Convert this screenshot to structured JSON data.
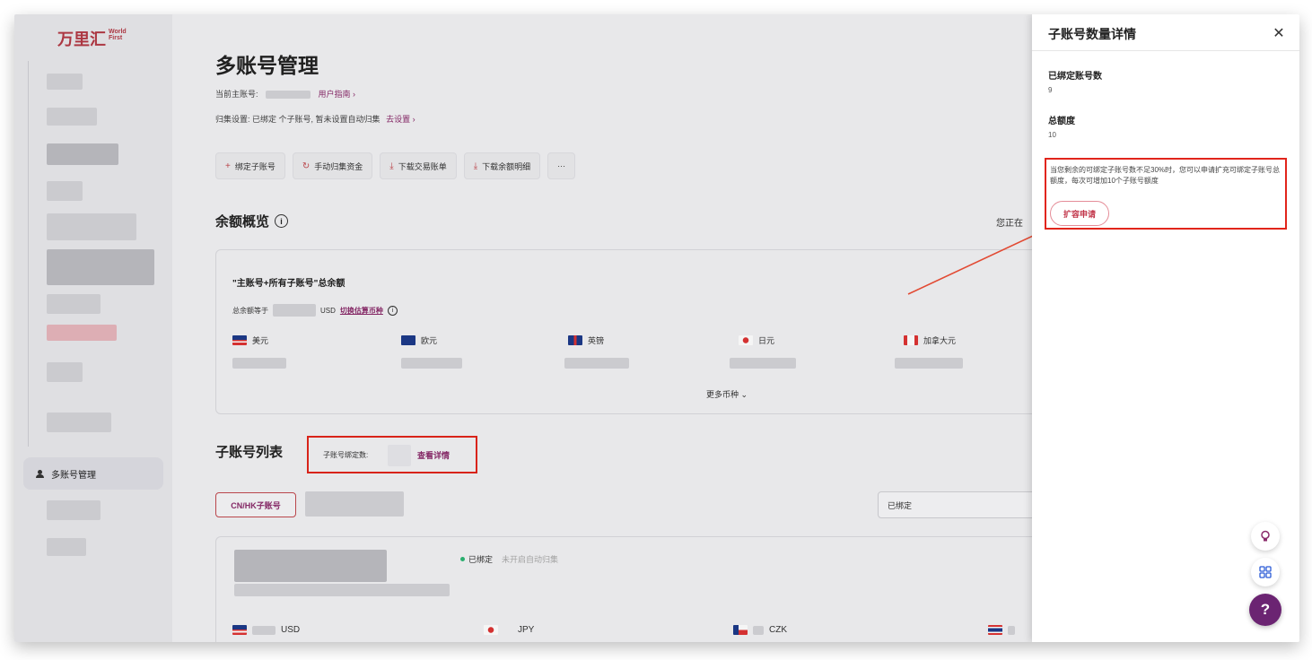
{
  "brand": {
    "name": "万里汇",
    "sub": "World First"
  },
  "sidebar": {
    "active_item": "多账号管理"
  },
  "page": {
    "title": "多账号管理",
    "main_account_label": "当前主账号:",
    "user_guide": "用户指南 ›",
    "collect_settings_prefix": "归集设置: 已绑定",
    "collect_settings_suffix": "个子账号, 暂未设置自动归集",
    "go_settings": "去设置 ›"
  },
  "toolbar": {
    "bind_sub": "绑定子账号",
    "manual_collect": "手动归集资金",
    "download_statement": "下载交易账单",
    "download_balance": "下载余额明细",
    "more": "···"
  },
  "balance": {
    "title": "余额概览",
    "right_text": "您正在",
    "card_title": "\"主账号+所有子账号\"总余额",
    "total_label": "总余额等于",
    "total_currency": "USD",
    "switch_currency": "切换估算币种",
    "currencies": [
      "美元",
      "欧元",
      "英镑",
      "日元",
      "加拿大元"
    ],
    "more_currencies": "更多币种 ⌄"
  },
  "sub_accounts": {
    "title": "子账号列表",
    "bind_count_label": "子账号绑定数:",
    "view_detail": "查看详情",
    "tab_active": "CN/HK子账号",
    "filter_value": "已绑定",
    "row_status": "已绑定",
    "row_auto": "未开启自动归集",
    "row_currencies": [
      "USD",
      "JPY",
      "CZK"
    ]
  },
  "drawer": {
    "title": "子账号数量详情",
    "close": "✕",
    "bound_label": "已绑定账号数",
    "bound_value": "9",
    "total_label": "总额度",
    "total_value": "10",
    "notice": "当您剩余的可绑定子账号数不足30%时，您可以申请扩充可绑定子账号总额度，每次可增加10个子账号额度",
    "expand_button": "扩容申请"
  },
  "float": {
    "help": "?"
  },
  "colors": {
    "brand": "#b33a45",
    "accent": "#8a2a6a",
    "highlight": "#e1251b",
    "help_bg": "#6b2472"
  }
}
